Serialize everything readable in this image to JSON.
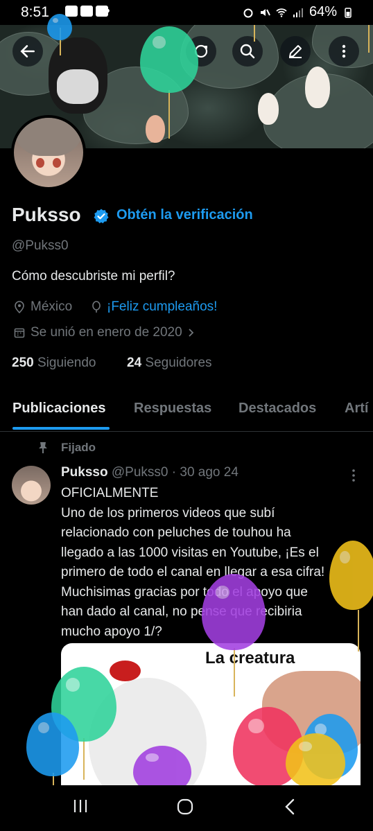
{
  "status_bar": {
    "time": "8:51",
    "battery": "64%"
  },
  "header": {
    "back_icon": "arrow-left-icon",
    "icons": [
      "refresh-icon",
      "search-icon",
      "edit-icon",
      "more-vertical-icon"
    ]
  },
  "profile": {
    "name": "Puksso",
    "verify_link": "Obtén la verificación",
    "handle": "@Pukss0",
    "bio": "Cómo descubriste mi perfil?",
    "location": "México",
    "birthday": "¡Feliz cumpleaños!",
    "joined": "Se unió en enero de 2020",
    "following_count": "250",
    "following_label": "Siguiendo",
    "followers_count": "24",
    "followers_label": "Seguidores"
  },
  "tabs": [
    {
      "label": "Publicaciones",
      "active": true
    },
    {
      "label": "Respuestas",
      "active": false
    },
    {
      "label": "Destacados",
      "active": false
    },
    {
      "label": "Artí",
      "active": false
    }
  ],
  "post": {
    "pinned_label": "Fijado",
    "author": "Puksso",
    "handle": "@Pukss0",
    "date": "· 30 ago 24",
    "lines": [
      "OFICIALMENTE",
      "Uno de los primeros videos que subí",
      "relacionado con peluches de touhou ha",
      "llegado a las 1000 visitas en Youtube, ¡Es el",
      "primero de todo el canal en llegar a esa cifra!",
      "Muchisimas gracias por todo el apoyo que",
      "han dado al canal, no pense que recibiria",
      "mucho apoyo 1/?"
    ],
    "media_caption": "La creatura"
  },
  "colors": {
    "accent": "#1d9bf0",
    "muted": "#71767b",
    "text": "#e7e9ea",
    "background": "#000000"
  }
}
